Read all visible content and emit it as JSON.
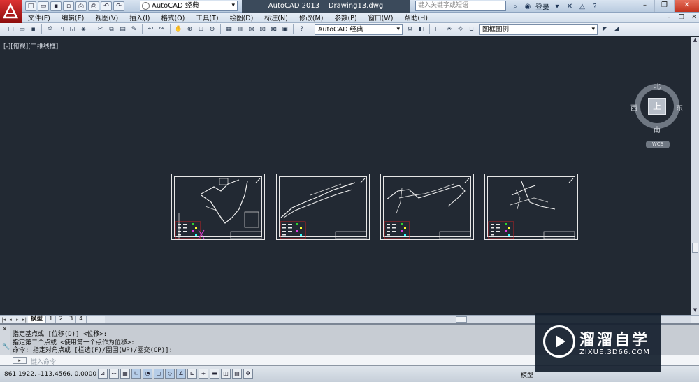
{
  "window": {
    "app_name": "AutoCAD 2013",
    "file_name": "Drawing13.dwg",
    "workspace": "AutoCAD 经典",
    "search_placeholder": "键入关键字或短语",
    "login": "登录",
    "help": "?"
  },
  "menu": [
    "文件(F)",
    "编辑(E)",
    "视图(V)",
    "插入(I)",
    "格式(O)",
    "工具(T)",
    "绘图(D)",
    "标注(N)",
    "修改(M)",
    "参数(P)",
    "窗口(W)",
    "帮助(H)"
  ],
  "toolbar": {
    "workspace_select": "AutoCAD 经典",
    "layer_select": "图框图例"
  },
  "viewport": {
    "label": "[-][俯视][二维线框]"
  },
  "viewcube": {
    "north": "北",
    "south": "南",
    "west": "西",
    "east": "东",
    "face": "上",
    "wcs": "WCS"
  },
  "layout_tabs": [
    "模型",
    "1",
    "2",
    "3",
    "4"
  ],
  "command": {
    "history": [
      "指定基点或 [位移(D)] <位移>:",
      "指定第二个点或 <使用第一个点作为位移>:",
      "命令: 指定对角点或 [栏选(F)/圈围(WP)/圈交(CP)]:"
    ],
    "input_placeholder": "键入命令"
  },
  "status": {
    "coordinates": "861.1922,  -113.4566, 0.0000",
    "model": "模型"
  },
  "watermark": {
    "name": "溜溜自学",
    "url": "ZIXUE.3D66.COM"
  }
}
